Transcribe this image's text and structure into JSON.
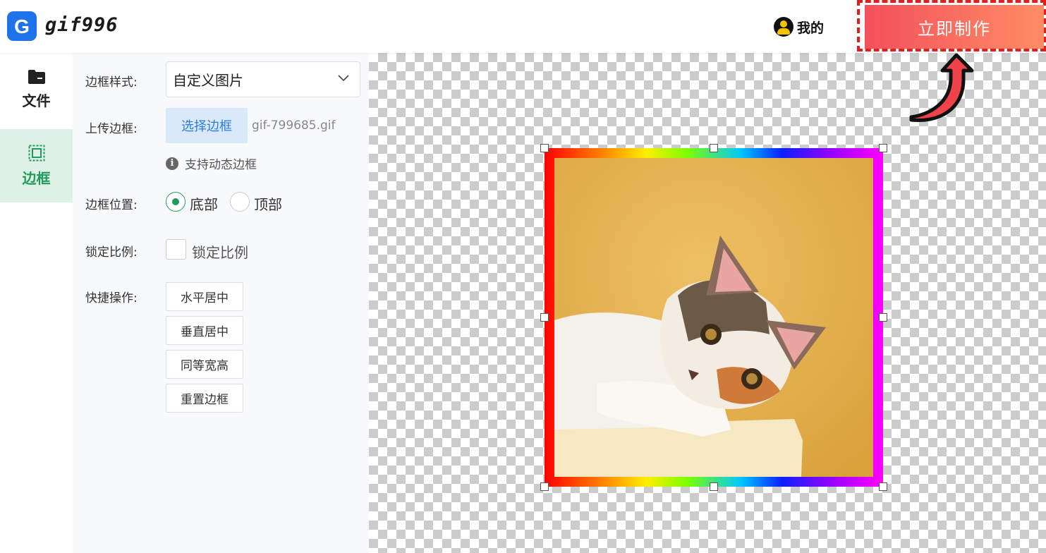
{
  "header": {
    "logo_letter": "G",
    "brand": "gif996",
    "user_label": "我的",
    "make_button": "立即制作"
  },
  "sidebar": {
    "items": [
      {
        "label": "文件",
        "icon": "folder-icon"
      },
      {
        "label": "边框",
        "icon": "frame-icon",
        "active": true
      }
    ]
  },
  "panel": {
    "style_label": "边框样式:",
    "style_value": "自定义图片",
    "upload_label": "上传边框:",
    "upload_button": "选择边框",
    "upload_filename": "gif-799685.gif",
    "hint_icon": "i",
    "hint": "支持动态边框",
    "position_label": "边框位置:",
    "position_options": [
      {
        "label": "底部",
        "selected": true
      },
      {
        "label": "顶部",
        "selected": false
      }
    ],
    "ratio_label": "锁定比例:",
    "ratio_checkbox_label": "锁定比例",
    "ratio_checked": false,
    "quick_label": "快捷操作:",
    "quick_actions": [
      "水平居中",
      "垂直居中",
      "同等宽高",
      "重置边框"
    ]
  },
  "colors": {
    "primary_blue": "#1e73ea",
    "accent_green": "#1f9c5c",
    "make_button_start": "#f3505c",
    "make_button_end": "#ff8c64",
    "highlight_red": "#e01e1e"
  }
}
